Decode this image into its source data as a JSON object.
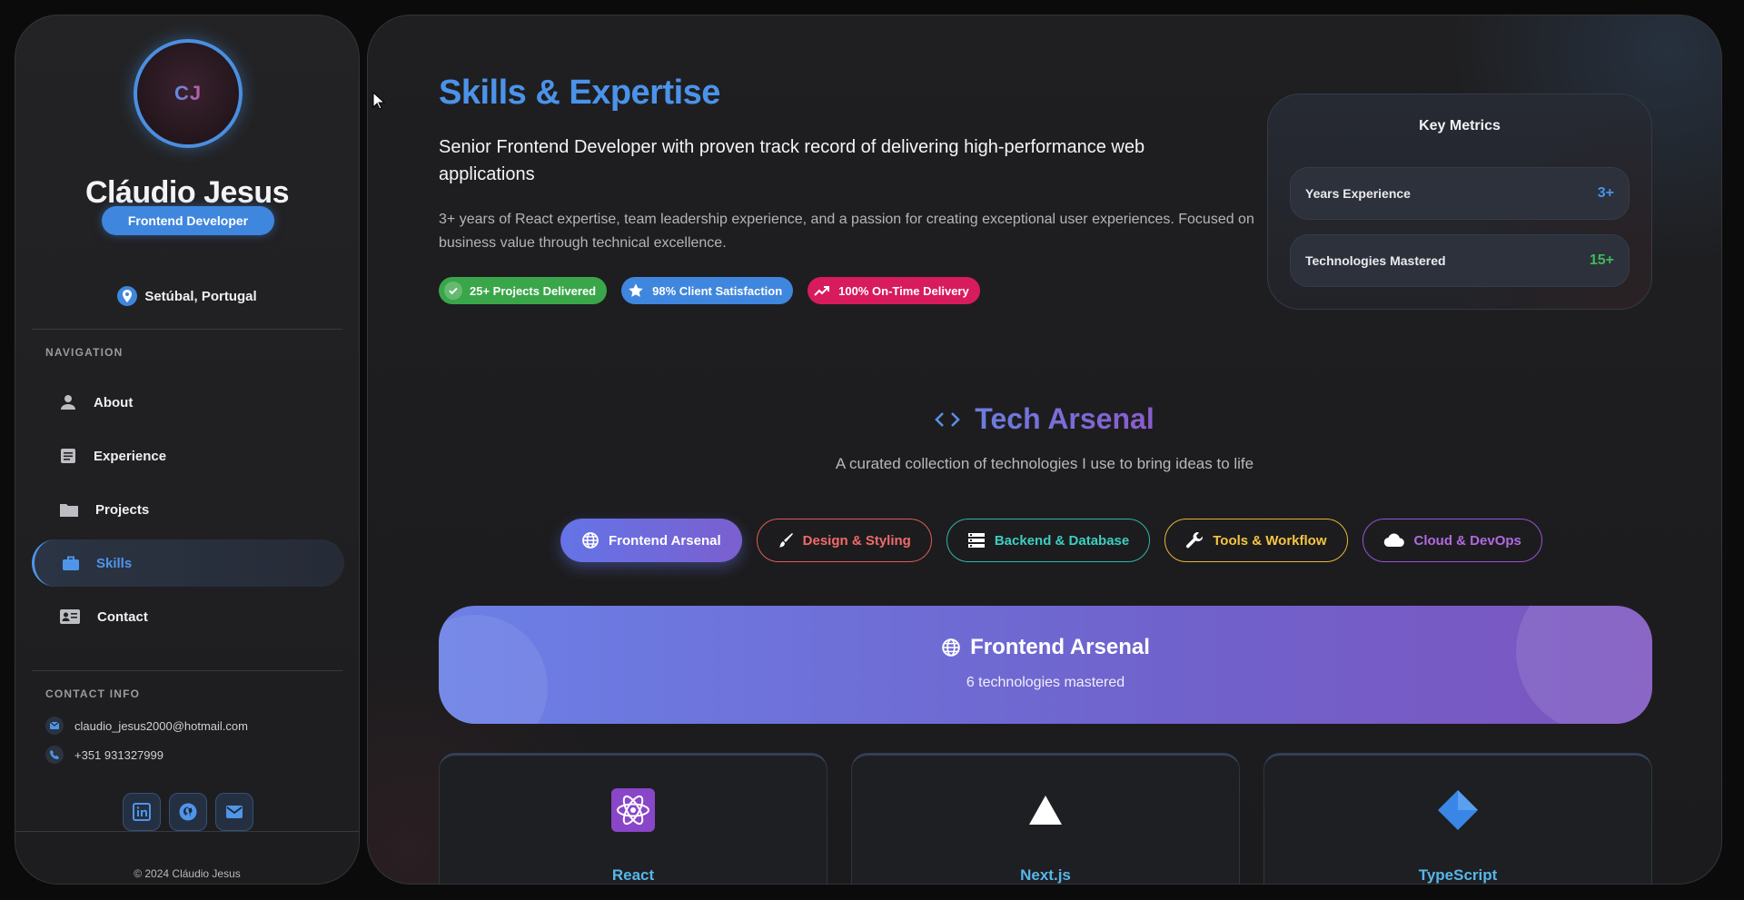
{
  "sidebar": {
    "avatar_initials": "CJ",
    "name": "Cláudio Jesus",
    "role": "Frontend Developer",
    "location": "Setúbal, Portugal",
    "nav_title": "NAVIGATION",
    "nav": [
      {
        "label": "About",
        "icon": "person-icon"
      },
      {
        "label": "Experience",
        "icon": "document-icon"
      },
      {
        "label": "Projects",
        "icon": "folder-icon"
      },
      {
        "label": "Skills",
        "icon": "briefcase-icon",
        "active": true
      },
      {
        "label": "Contact",
        "icon": "contact-card-icon"
      }
    ],
    "contact_title": "CONTACT INFO",
    "email": "claudio_jesus2000@hotmail.com",
    "phone": "+351 931327999",
    "socials": [
      "linkedin-icon",
      "github-icon",
      "mail-icon"
    ],
    "copyright": "© 2024 Cláudio Jesus"
  },
  "hero": {
    "title": "Skills & Expertise",
    "subtitle": "Senior Frontend Developer with proven track record of delivering high-performance web applications",
    "description": "3+ years of React expertise, team leadership experience, and a passion for creating exceptional user experiences. Focused on business value through technical excellence.",
    "pills": [
      {
        "label": "25+ Projects Delivered",
        "color": "#3aa64a",
        "icon": "check-circle-icon"
      },
      {
        "label": "98% Client Satisfaction",
        "color": "#3f86de",
        "icon": "star-icon"
      },
      {
        "label": "100% On-Time Delivery",
        "color": "#d81b5c",
        "icon": "trending-up-icon"
      }
    ]
  },
  "metrics": {
    "title": "Key Metrics",
    "rows": [
      {
        "label": "Years Experience",
        "value": "3+",
        "color": "#4b93ea"
      },
      {
        "label": "Technologies Mastered",
        "value": "15+",
        "color": "#3fb95a"
      }
    ]
  },
  "arsenal": {
    "title": "Tech Arsenal",
    "subtitle": "A curated collection of technologies I use to bring ideas to life",
    "tabs": [
      {
        "label": "Frontend Arsenal",
        "icon": "globe-icon",
        "color": "#ffffff",
        "active": true
      },
      {
        "label": "Design & Styling",
        "icon": "brush-icon",
        "color": "#f06a6a"
      },
      {
        "label": "Backend & Database",
        "icon": "server-icon",
        "color": "#3ccfc0"
      },
      {
        "label": "Tools & Workflow",
        "icon": "wrench-icon",
        "color": "#f5c542"
      },
      {
        "label": "Cloud & DevOps",
        "icon": "cloud-icon",
        "color": "#b06ae0"
      }
    ],
    "banner_title": "Frontend Arsenal",
    "banner_sub": "6 technologies mastered",
    "cards": [
      {
        "name": "React",
        "icon": "react-atom-icon"
      },
      {
        "name": "Next.js",
        "icon": "triangle-icon"
      },
      {
        "name": "TypeScript",
        "icon": "diamond-icon"
      }
    ]
  }
}
